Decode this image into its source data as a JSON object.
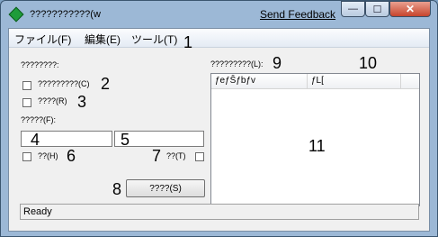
{
  "window": {
    "title": "???????????(w",
    "feedback": "Send Feedback",
    "min_glyph": "—",
    "max_glyph": "☐",
    "close_glyph": "✕"
  },
  "menu": {
    "file": "ファイル(F)",
    "edit": "編集(E)",
    "tools": "ツール(T)"
  },
  "left": {
    "section_label": "????????:",
    "check1_label": "?????????(C)",
    "check2_label": "????(R)",
    "field_label": "?????(F):",
    "check3_label": "??(H)",
    "check4_label": "??(T)",
    "action_button": "????(S)"
  },
  "right": {
    "list_label": "?????????(L):",
    "columns": [
      "ƒeƒŠƒbƒv",
      "ƒL["
    ]
  },
  "status": {
    "text": "Ready"
  },
  "annotations": [
    "1",
    "2",
    "3",
    "4",
    "5",
    "6",
    "7",
    "8",
    "9",
    "10",
    "11"
  ]
}
